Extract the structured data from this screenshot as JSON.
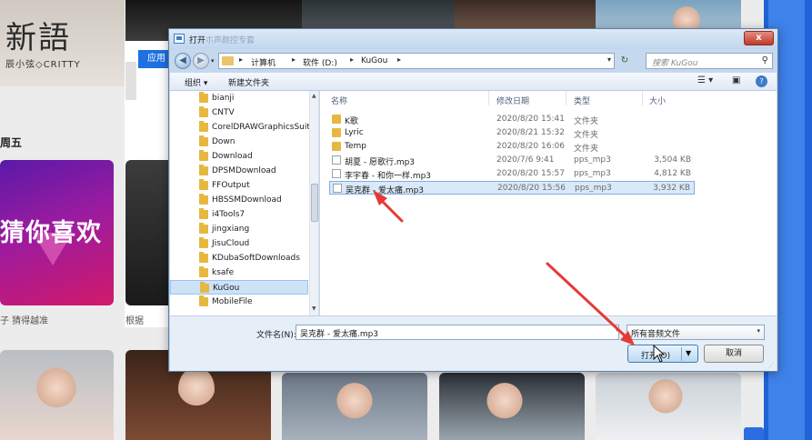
{
  "background_app": {
    "logo_text": "新語",
    "logo_sub": "辰小弦◇CRITTY",
    "blue_tab": "应用",
    "day_label": "周五",
    "featured_text": "猜你喜欢",
    "featured_caption": "子 猜得越准",
    "side_caption": "根据"
  },
  "dialog": {
    "title": "打开",
    "title_ghost": "ホ声颜控专套",
    "close_label": "x",
    "address": {
      "segments": [
        "计算机",
        "软件 (D:)",
        "KuGou"
      ],
      "separator": "▸"
    },
    "search_placeholder": "搜索 KuGou",
    "toolbar": {
      "organize": "组织 ▾",
      "new_folder": "新建文件夹"
    },
    "nav_items": [
      "bianji",
      "CNTV",
      "CorelDRAWGraphicsSuite",
      "Down",
      "Download",
      "DPSMDownload",
      "FFOutput",
      "HBSSMDownload",
      "i4Tools7",
      "jingxiang",
      "JisuCloud",
      "KDubaSoftDownloads",
      "ksafe",
      "KuGou",
      "MobileFile"
    ],
    "columns": {
      "name": "名称",
      "date": "修改日期",
      "type": "类型",
      "size": "大小"
    },
    "files": [
      {
        "name": "K歌",
        "date": "2020/8/20 15:41",
        "type": "文件夹",
        "size": ""
      },
      {
        "name": "Lyric",
        "date": "2020/8/21 15:32",
        "type": "文件夹",
        "size": ""
      },
      {
        "name": "Temp",
        "date": "2020/8/20 16:06",
        "type": "文件夹",
        "size": ""
      },
      {
        "name": "胡夏 - 愿歌行.mp3",
        "date": "2020/7/6 9:41",
        "type": "pps_mp3",
        "size": "3,504 KB"
      },
      {
        "name": "李宇春 - 和你一样.mp3",
        "date": "2020/8/20 15:57",
        "type": "pps_mp3",
        "size": "4,812 KB"
      },
      {
        "name": "吴克群 - 爱太痛.mp3",
        "date": "2020/8/20 15:56",
        "type": "pps_mp3",
        "size": "3,932 KB"
      }
    ],
    "filename_label": "文件名(N):",
    "filename_value": "吴克群 - 爱太痛.mp3",
    "filetype_value": "所有音频文件",
    "open_label": "打开(O)",
    "cancel_label": "取消"
  },
  "colors": {
    "accent": "#1f70e0",
    "annotation_red": "#e53935"
  }
}
